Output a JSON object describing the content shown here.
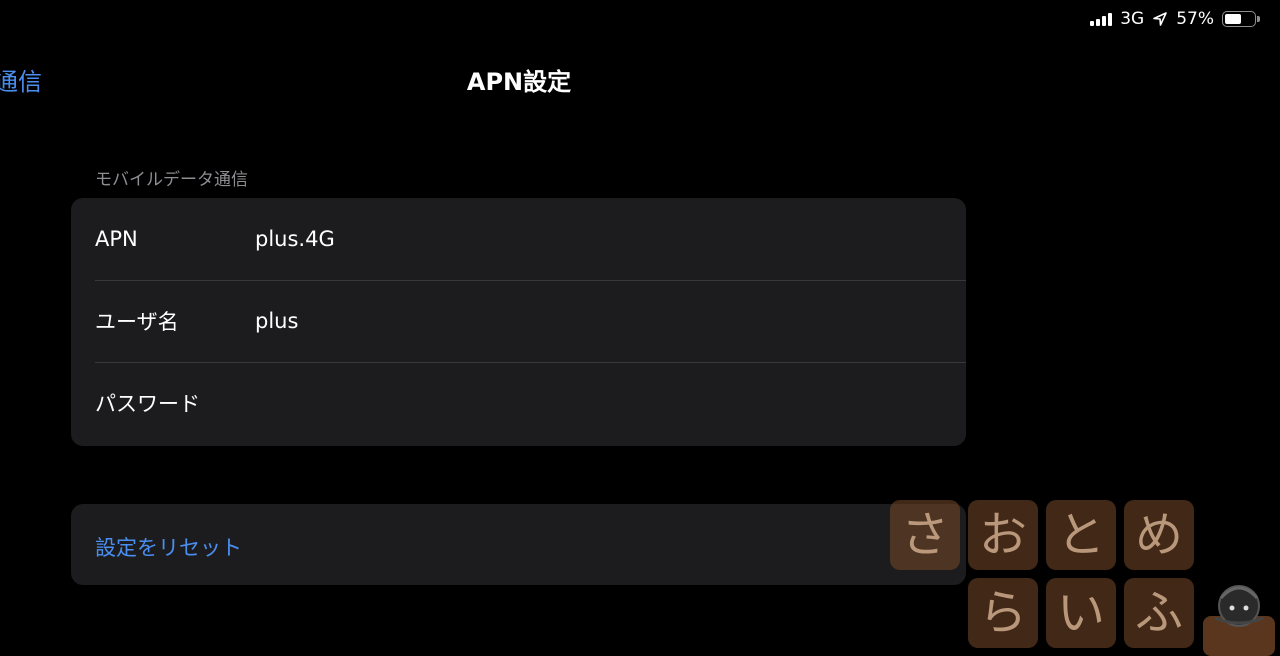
{
  "status_bar": {
    "network": "3G",
    "battery_percent": "57%",
    "battery_level": 0.57
  },
  "nav": {
    "back_label": "通信",
    "title": "APN設定"
  },
  "section": {
    "header": "モバイルデータ通信"
  },
  "fields": [
    {
      "label": "APN",
      "value": "plus.4G"
    },
    {
      "label": "ユーザ名",
      "value": "plus"
    },
    {
      "label": "パスワード",
      "value": ""
    }
  ],
  "reset": {
    "label": "設定をリセット"
  },
  "watermark": {
    "chars": [
      "さ",
      "お",
      "と",
      "め",
      "ら",
      "い",
      "ふ"
    ]
  },
  "colors": {
    "background": "#000000",
    "group_bg": "#1c1c1e",
    "accent": "#4a8ff0",
    "secondary_text": "#8e8e93"
  }
}
